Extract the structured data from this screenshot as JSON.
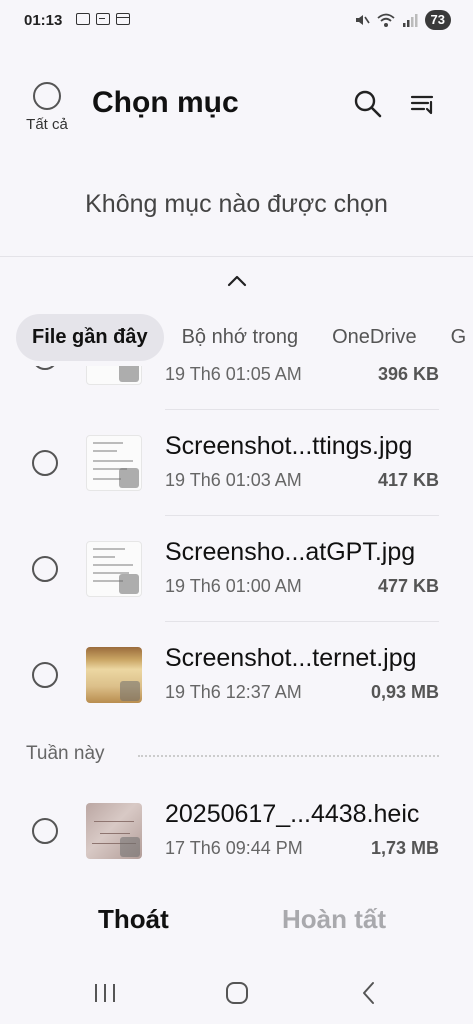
{
  "status_bar": {
    "time": "01:13",
    "battery": "73",
    "left_icons": [
      "screenshot-icon",
      "gallery-icon",
      "calendar-icon"
    ],
    "right_icons": [
      "mute-icon",
      "wifi-icon",
      "signal-icon",
      "battery-icon"
    ]
  },
  "header": {
    "select_all_label": "Tất cả",
    "title": "Chọn mục",
    "search_icon": "search-icon",
    "sort_icon": "sort-icon"
  },
  "selection": {
    "empty_text": "Không mục nào được chọn"
  },
  "tabs": [
    {
      "label": "File gần đây",
      "active": true
    },
    {
      "label": "Bộ nhớ trong",
      "active": false
    },
    {
      "label": "OneDrive",
      "active": false
    },
    {
      "label": "G",
      "active": false
    }
  ],
  "files_top": [
    {
      "name": "",
      "date": "19 Th6 01:05 AM",
      "size": "396 KB",
      "thumb": "doc"
    },
    {
      "name": "Screenshot...ttings.jpg",
      "date": "19 Th6 01:03 AM",
      "size": "417 KB",
      "thumb": "doc"
    },
    {
      "name": "Screensho...atGPT.jpg",
      "date": "19 Th6 01:00 AM",
      "size": "477 KB",
      "thumb": "doc"
    },
    {
      "name": "Screenshot...ternet.jpg",
      "date": "19 Th6 12:37 AM",
      "size": "0,93 MB",
      "thumb": "photo"
    }
  ],
  "section": {
    "label": "Tuần này"
  },
  "files_week": [
    {
      "name": "20250617_...4438.heic",
      "date": "17 Th6 09:44 PM",
      "size": "1,73 MB",
      "thumb": "heic"
    }
  ],
  "actions": {
    "exit_label": "Thoát",
    "done_label": "Hoàn tất"
  },
  "navbar": {
    "icons": [
      "recents-icon",
      "home-icon",
      "back-icon"
    ]
  },
  "colors": {
    "background": "#f7f6fa",
    "tab_active_bg": "#e5e4ea",
    "disabled_text": "#a9a9ad"
  }
}
